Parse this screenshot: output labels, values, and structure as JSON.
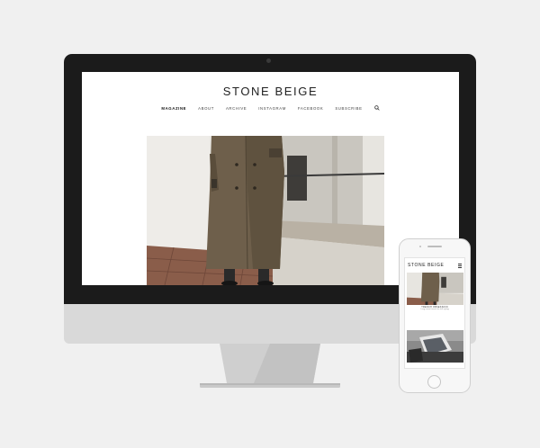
{
  "site": {
    "logo": "STONE BEIGE",
    "nav": [
      {
        "label": "MAGAZINE",
        "active": true
      },
      {
        "label": "ABOUT",
        "active": false
      },
      {
        "label": "ARCHIVE",
        "active": false
      },
      {
        "label": "INSTAGRAM",
        "active": false
      },
      {
        "label": "FACEBOOK",
        "active": false
      },
      {
        "label": "SUBSCRIBE",
        "active": false
      }
    ],
    "search_icon": "search-icon"
  },
  "mobile": {
    "logo": "STONE BEIGE",
    "menu_icon": "hamburger-icon",
    "caption_title": "TRENCH OBSESSION",
    "caption_sub": "Long camel trench for fall styling"
  },
  "colors": {
    "background": "#f0f0f0",
    "bezel": "#1b1b1b",
    "chin": "#d9d9d9",
    "coat": "#6e5f4b",
    "wall": "#e6e4df"
  }
}
